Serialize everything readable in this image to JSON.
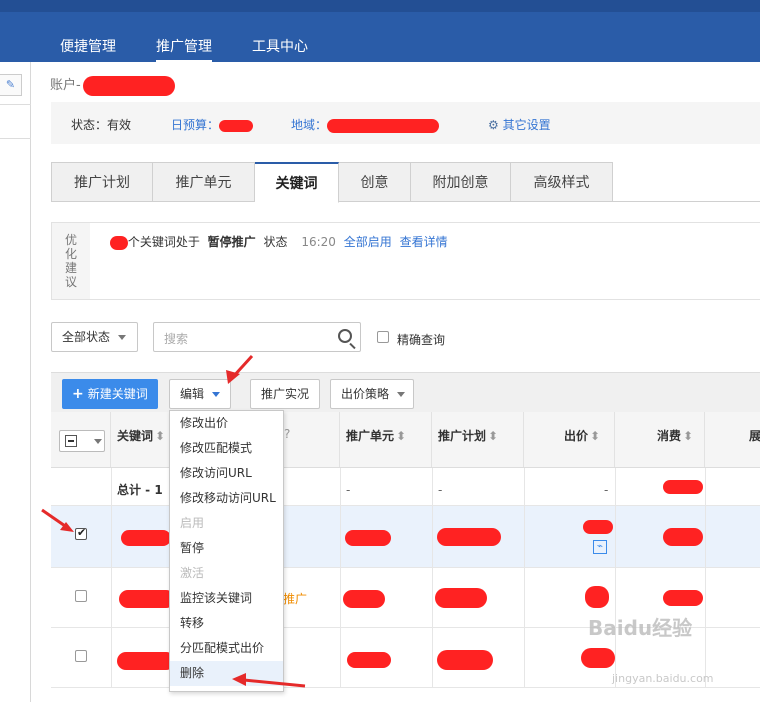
{
  "topnav": [
    "便捷管理",
    "推广管理",
    "工具中心"
  ],
  "account_label": "账户-",
  "infobar": {
    "status": "状态：有效",
    "budget": "日预算：",
    "region": "地域：",
    "other": "其它设置"
  },
  "tabs": [
    "推广计划",
    "推广单元",
    "关键词",
    "创意",
    "附加创意",
    "高级样式"
  ],
  "suggest": {
    "title": [
      "优",
      "化",
      "建",
      "议"
    ],
    "msg_prefix": "个关键词处于",
    "msg_bold": "暂停推广",
    "msg_suffix": "状态",
    "time": "16:20",
    "link1": "全部启用",
    "link2": "查看详情"
  },
  "filter": {
    "status": "全部状态",
    "search_placeholder": "搜索",
    "exact": "精确查询"
  },
  "toolbar": {
    "new_keyword": "新建关键词",
    "edit": "编辑",
    "report": "推广实况",
    "bid_strategy": "出价策略"
  },
  "table": {
    "headers": [
      "关键词",
      "推广单元",
      "推广计划",
      "出价",
      "消费",
      "展"
    ],
    "total": "总计 - 1",
    "dash": "-",
    "promo_text": "推广"
  },
  "edit_menu": [
    {
      "label": "修改出价",
      "disabled": false
    },
    {
      "label": "修改匹配模式",
      "disabled": false
    },
    {
      "label": "修改访问URL",
      "disabled": false
    },
    {
      "label": "修改移动访问URL",
      "disabled": false
    },
    {
      "label": "启用",
      "disabled": true
    },
    {
      "label": "暂停",
      "disabled": false
    },
    {
      "label": "激活",
      "disabled": true
    },
    {
      "label": "监控该关键词",
      "disabled": false
    },
    {
      "label": "转移",
      "disabled": false
    },
    {
      "label": "分匹配模式出价",
      "disabled": false
    },
    {
      "label": "删除",
      "disabled": false
    }
  ],
  "watermark": "Baidu经验",
  "watermark_url": "jingyan.baidu.com",
  "colors": {
    "brand": "#2a5ca8",
    "primary_button": "#3b8bea",
    "redaction": "#f22222",
    "arrow": "#e52a2a"
  }
}
